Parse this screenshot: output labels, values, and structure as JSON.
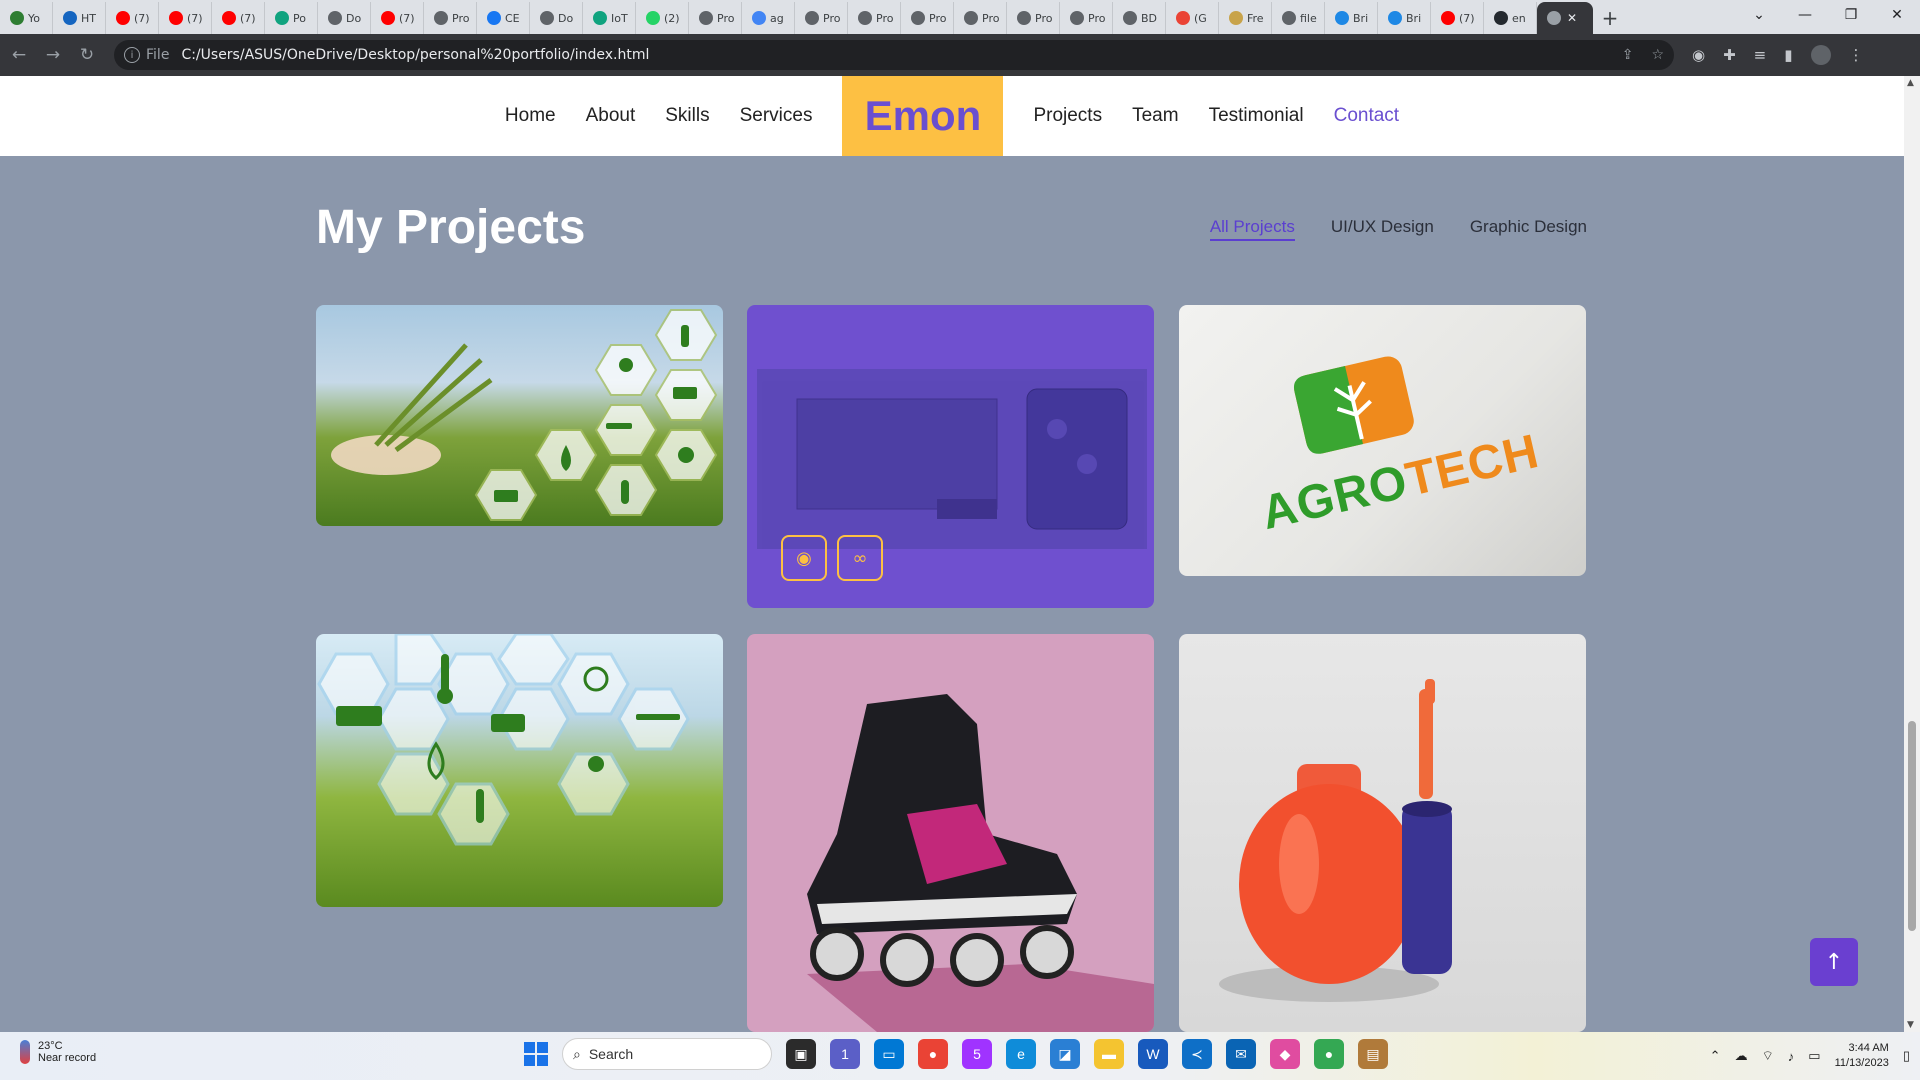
{
  "browser": {
    "tabs": [
      {
        "label": "Yo",
        "color": "#2e7d32"
      },
      {
        "label": "HT",
        "color": "#1565c0"
      },
      {
        "label": "(7)",
        "color": "#ff0000"
      },
      {
        "label": "(7)",
        "color": "#ff0000"
      },
      {
        "label": "(7)",
        "color": "#ff0000"
      },
      {
        "label": "Po",
        "color": "#10a37f"
      },
      {
        "label": "Do",
        "color": "#5f6368"
      },
      {
        "label": "(7)",
        "color": "#ff0000"
      },
      {
        "label": "Pro",
        "color": "#5f6368"
      },
      {
        "label": "CE",
        "color": "#1877f2"
      },
      {
        "label": "Do",
        "color": "#5f6368"
      },
      {
        "label": "IoT",
        "color": "#10a37f"
      },
      {
        "label": "(2)",
        "color": "#25d366"
      },
      {
        "label": "Pro",
        "color": "#5f6368"
      },
      {
        "label": "ag",
        "color": "#4285f4"
      },
      {
        "label": "Pro",
        "color": "#5f6368"
      },
      {
        "label": "Pro",
        "color": "#5f6368"
      },
      {
        "label": "Pro",
        "color": "#5f6368"
      },
      {
        "label": "Pro",
        "color": "#5f6368"
      },
      {
        "label": "Pro",
        "color": "#5f6368"
      },
      {
        "label": "Pro",
        "color": "#5f6368"
      },
      {
        "label": "BD",
        "color": "#5f6368"
      },
      {
        "label": "(G",
        "color": "#ea4335"
      },
      {
        "label": "Fre",
        "color": "#c8a34a"
      },
      {
        "label": "file",
        "color": "#5f6368"
      },
      {
        "label": "Bri",
        "color": "#1e88e5"
      },
      {
        "label": "Bri",
        "color": "#1e88e5"
      },
      {
        "label": "(7)",
        "color": "#ff0000"
      },
      {
        "label": "en",
        "color": "#24292f"
      }
    ],
    "active_tab_label": "",
    "new_tab": "+",
    "url_scheme_label": "File",
    "url": "C:/Users/ASUS/OneDrive/Desktop/personal%20portfolio/index.html"
  },
  "nav": {
    "left": [
      "Home",
      "About",
      "Skills",
      "Services"
    ],
    "logo": "Emon",
    "right": [
      "Projects",
      "Team",
      "Testimonial",
      "Contact"
    ],
    "active": "Contact"
  },
  "projects": {
    "title": "My Projects",
    "filters": [
      "All Projects",
      "UI/UX Design",
      "Graphic Design"
    ],
    "active_filter": "All Projects",
    "agrotech_text_1": "AGRO",
    "agrotech_text_2": "TECH"
  },
  "colors": {
    "accent": "#6a4fd0",
    "logo_bg": "#fdc043",
    "page_bg": "#8b97ab"
  },
  "taskbar": {
    "temperature": "23°C",
    "weather_note": "Near record",
    "search_placeholder": "Search",
    "time": "3:44 AM",
    "date": "11/13/2023",
    "badges": {
      "teams": "1",
      "messenger": "5"
    }
  }
}
